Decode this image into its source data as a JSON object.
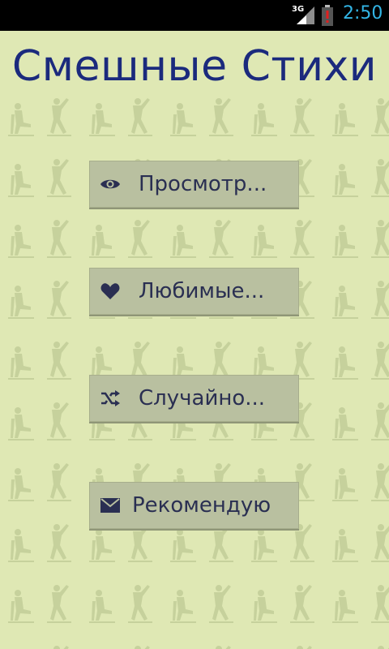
{
  "status_bar": {
    "network": "3G",
    "time": "2:50"
  },
  "app": {
    "title": "Смешные Стихи"
  },
  "menu": [
    {
      "label": "Просмотр...",
      "icon": "eye-icon"
    },
    {
      "label": "Любимые...",
      "icon": "heart-icon"
    },
    {
      "label": "Случайно...",
      "icon": "shuffle-icon"
    },
    {
      "label": "Рекомендую",
      "icon": "envelope-icon"
    }
  ],
  "colors": {
    "background": "#dfe8b4",
    "title": "#1b2a7d",
    "button": "#b9c0a0",
    "button_text": "#2a2f52",
    "status_accent": "#33b5e5"
  }
}
